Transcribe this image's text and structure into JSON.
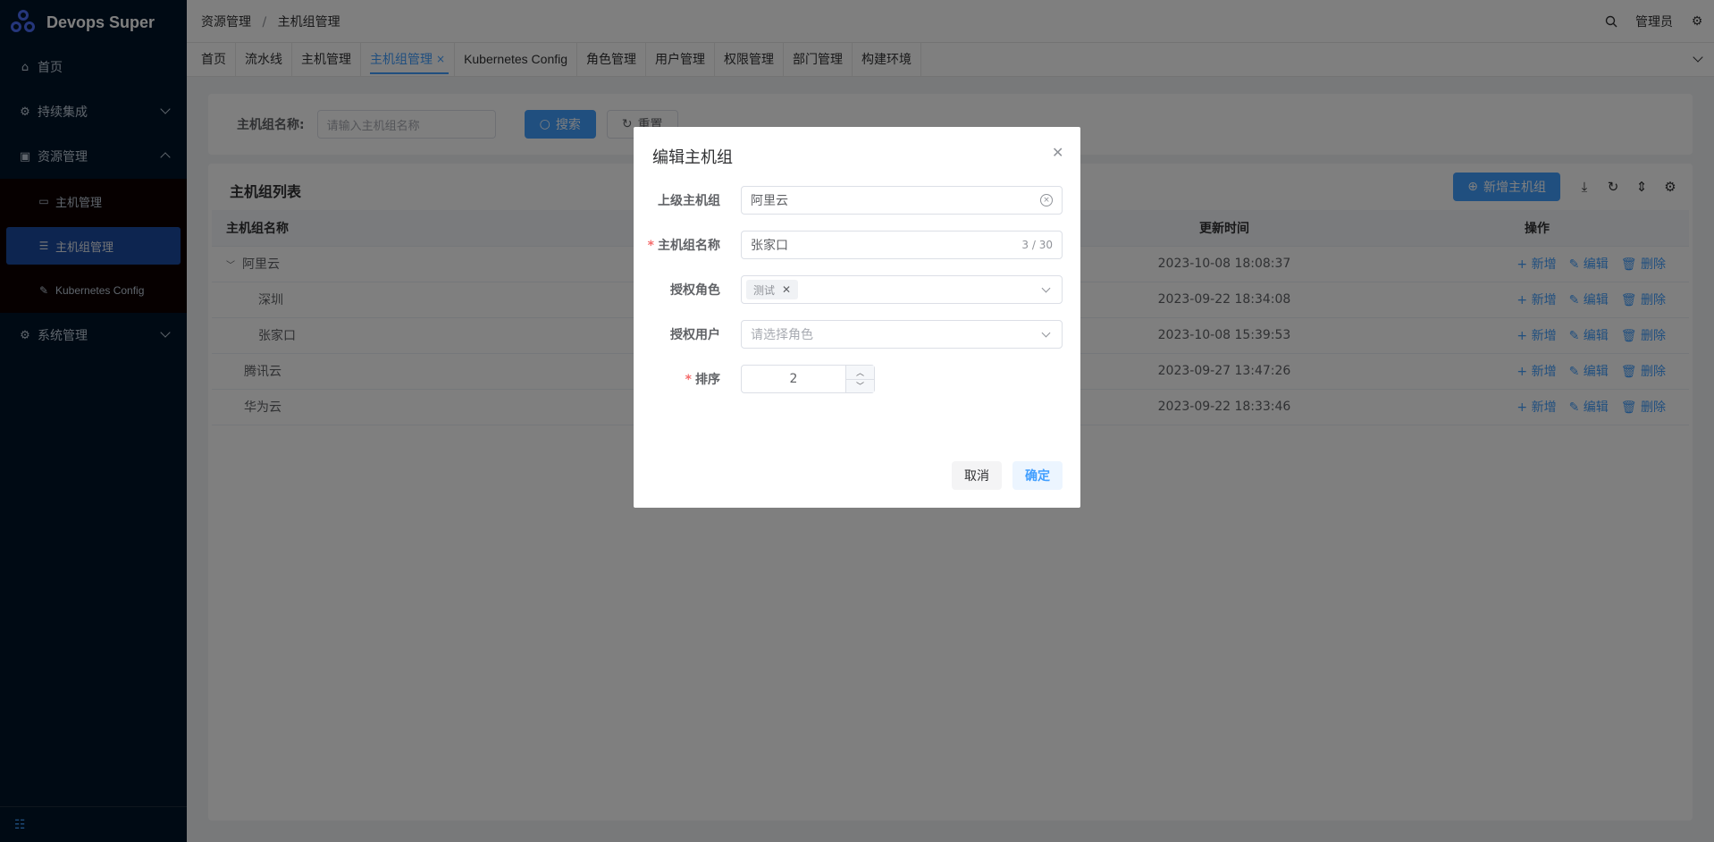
{
  "app": {
    "title": "Devops Super"
  },
  "sidebar": {
    "items": [
      {
        "label": "首页",
        "icon": "home-icon"
      },
      {
        "label": "持续集成",
        "icon": "ci-icon"
      },
      {
        "label": "资源管理",
        "icon": "resource-icon"
      },
      {
        "label": "系统管理",
        "icon": "gear-icon"
      }
    ],
    "sub_items": [
      {
        "label": "主机管理",
        "icon": "monitor-icon"
      },
      {
        "label": "主机组管理",
        "icon": "server-icon"
      },
      {
        "label": "Kubernetes Config",
        "icon": "k8s-icon"
      }
    ]
  },
  "header": {
    "breadcrumb": [
      "资源管理",
      "主机组管理"
    ],
    "separator": "/",
    "user": "管理员"
  },
  "tabs": [
    {
      "label": "首页"
    },
    {
      "label": "流水线"
    },
    {
      "label": "主机管理"
    },
    {
      "label": "主机组管理",
      "close": "×"
    },
    {
      "label": "Kubernetes Config"
    },
    {
      "label": "角色管理"
    },
    {
      "label": "用户管理"
    },
    {
      "label": "权限管理"
    },
    {
      "label": "部门管理"
    },
    {
      "label": "构建环境"
    }
  ],
  "search": {
    "label": "主机组名称:",
    "placeholder": "请输入主机组名称",
    "search_button": "搜索",
    "reset_button": "重置"
  },
  "table": {
    "title": "主机组列表",
    "add_button": "新增主机组",
    "columns": [
      "主机组名称",
      "更新时间",
      "操作"
    ],
    "rows": [
      {
        "name": "阿里云",
        "time": "2023-10-08 18:08:37",
        "level": 0,
        "expanded": true
      },
      {
        "name": "深圳",
        "time": "2023-09-22 18:34:08",
        "level": 1
      },
      {
        "name": "张家口",
        "time": "2023-10-08 15:39:53",
        "level": 1
      },
      {
        "name": "腾讯云",
        "time": "2023-09-27 13:47:26",
        "level": 0
      },
      {
        "name": "华为云",
        "time": "2023-09-22 18:33:46",
        "level": 0
      }
    ],
    "ops": {
      "add": "新增",
      "edit": "编辑",
      "delete": "删除"
    }
  },
  "dialog": {
    "title": "编辑主机组",
    "fields": {
      "parent": {
        "label": "上级主机组",
        "value": "阿里云"
      },
      "name": {
        "label": "主机组名称",
        "value": "张家口",
        "count": "3 / 30",
        "required": "*"
      },
      "roles": {
        "label": "授权角色",
        "tag": "测试"
      },
      "users": {
        "label": "授权用户",
        "placeholder": "请选择角色"
      },
      "sort": {
        "label": "排序",
        "value": "2",
        "required": "*"
      }
    },
    "cancel": "取消",
    "confirm": "确定"
  },
  "colors": {
    "primary": "#409eff",
    "sidebar_bg": "#001529",
    "danger": "#f56c6c"
  }
}
